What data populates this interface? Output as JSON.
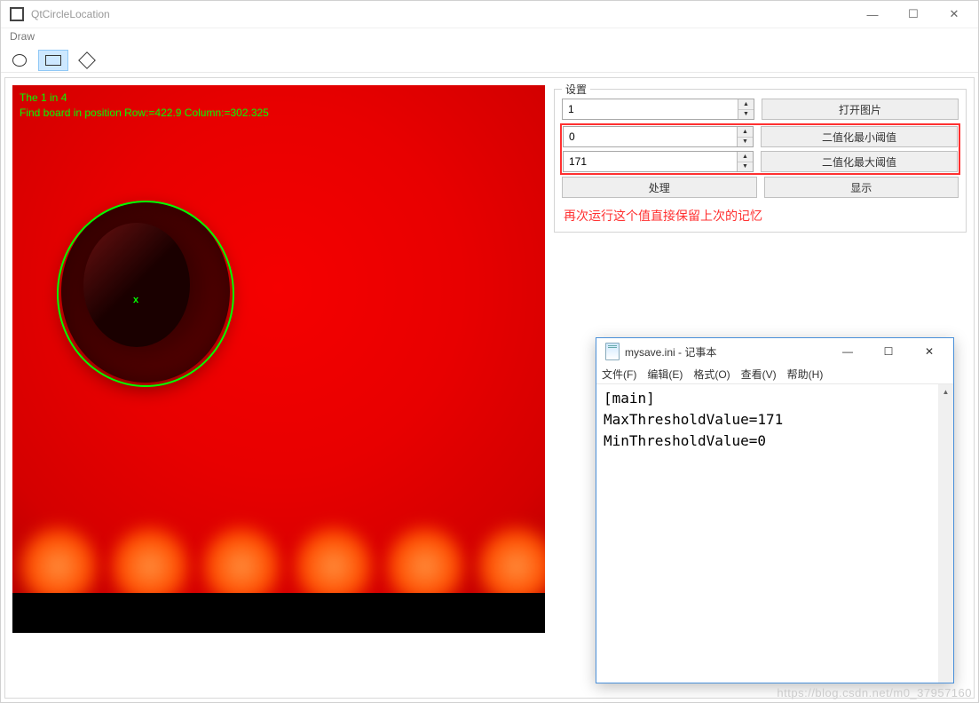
{
  "window": {
    "title": "QtCircleLocation",
    "menu_draw": "Draw"
  },
  "overlay": {
    "line1": "The 1 in 4",
    "line2": "Find board in position Row:=422.9 Column:=302.325"
  },
  "settings": {
    "group_title": "设置",
    "spin1_value": "1",
    "spin2_value": "0",
    "spin3_value": "171",
    "btn_open": "打开图片",
    "btn_min": "二值化最小阈值",
    "btn_max": "二值化最大阈值",
    "btn_process": "处理",
    "btn_show": "显示",
    "note": "再次运行这个值直接保留上次的记忆"
  },
  "notepad": {
    "title": "mysave.ini - 记事本",
    "menu_file": "文件(F)",
    "menu_edit": "编辑(E)",
    "menu_format": "格式(O)",
    "menu_view": "查看(V)",
    "menu_help": "帮助(H)",
    "content": "[main]\nMaxThresholdValue=171\nMinThresholdValue=0"
  },
  "watermark": "https://blog.csdn.net/m0_37957160"
}
